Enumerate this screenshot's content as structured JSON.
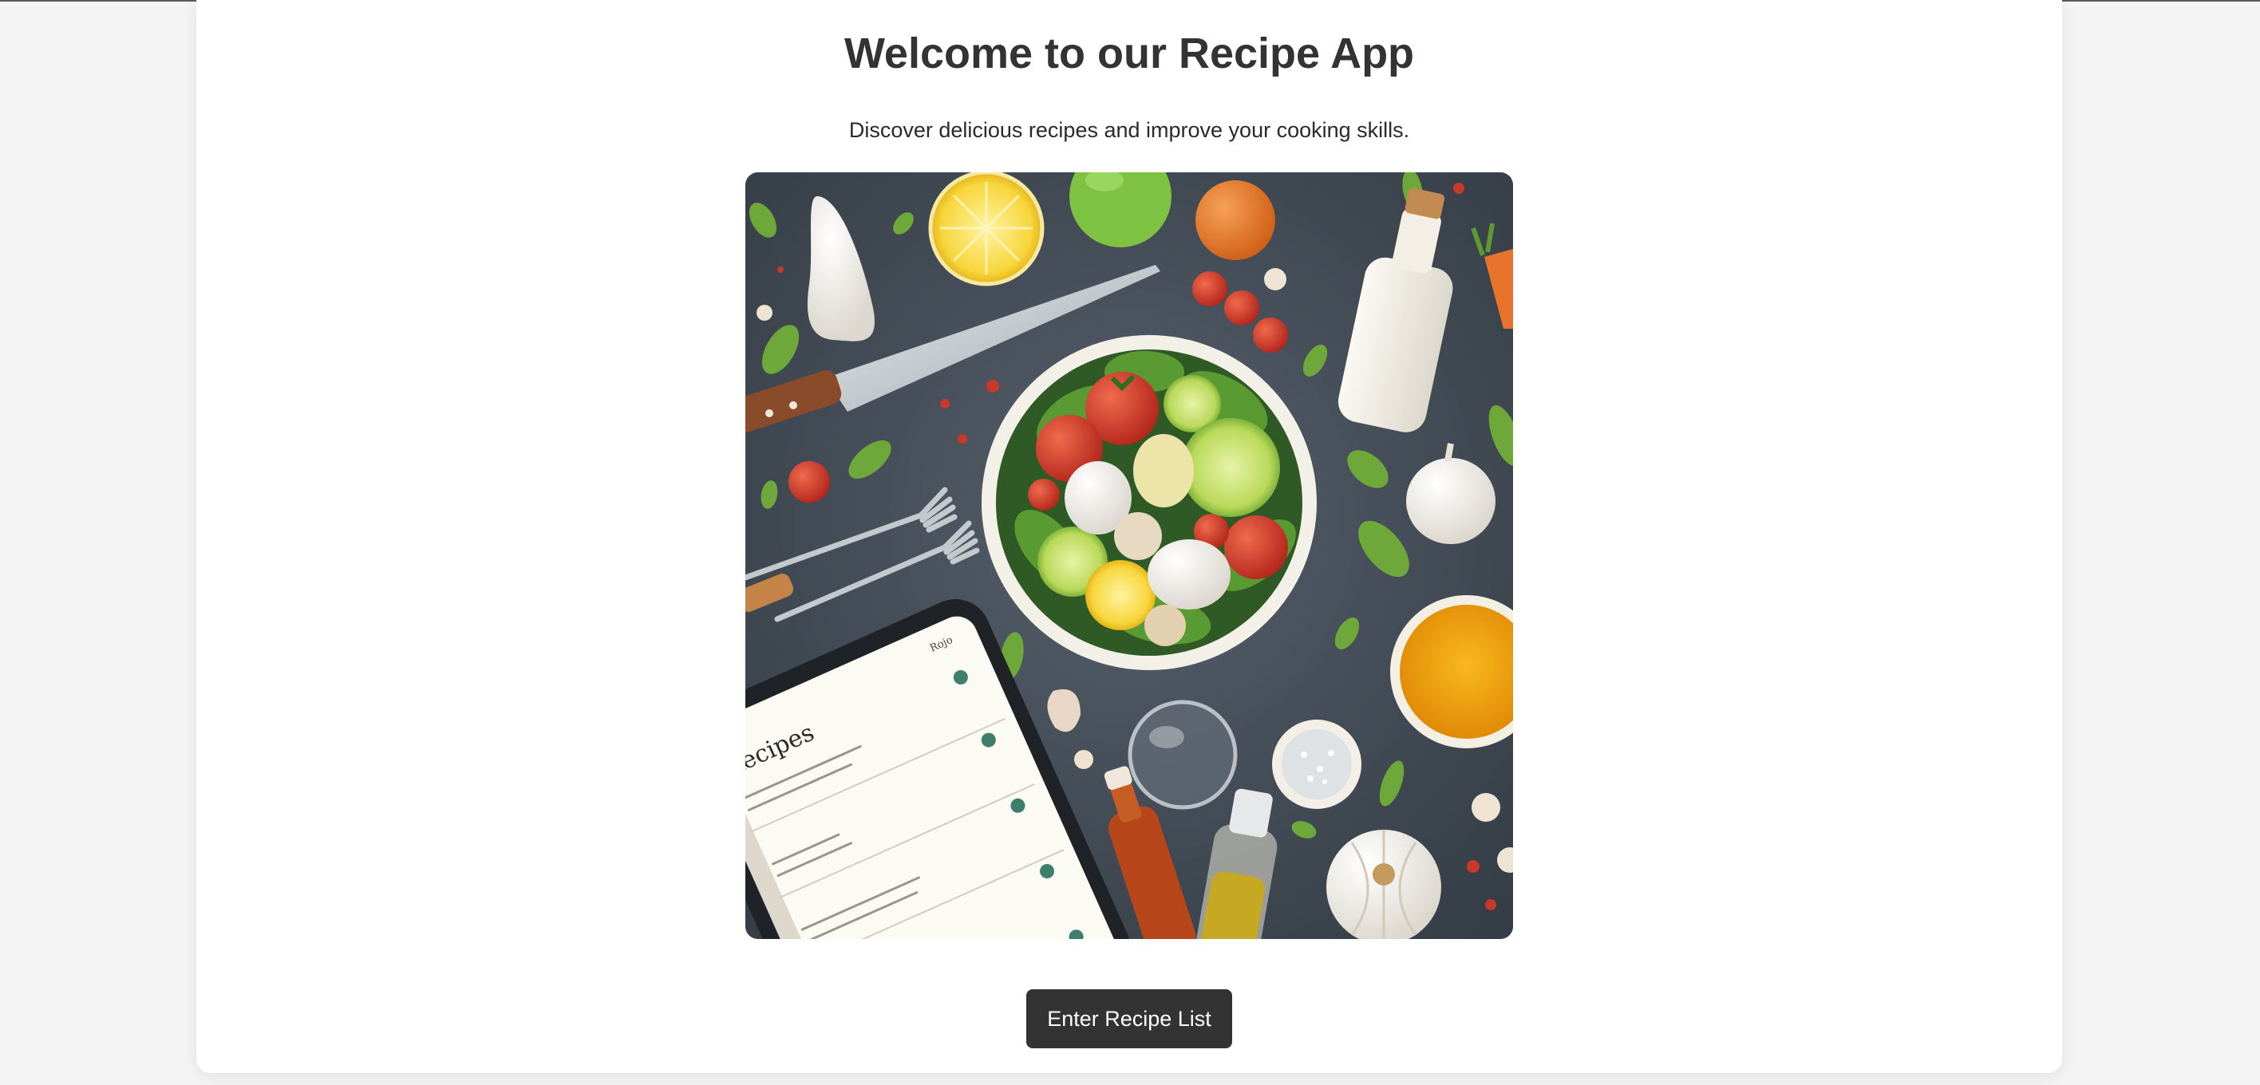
{
  "page": {
    "title": "Welcome to our Recipe App",
    "subtitle": "Discover delicious recipes and improve your cooking skills."
  },
  "hero": {
    "tablet": {
      "heading": "Recipes",
      "corner": "Rojo"
    }
  },
  "actions": {
    "enter_label": "Enter Recipe List"
  },
  "colors": {
    "button_bg": "#333333",
    "button_text": "#ffffff",
    "page_bg": "#f4f4f4",
    "card_bg": "#ffffff",
    "hero_bg": "#414b55"
  }
}
